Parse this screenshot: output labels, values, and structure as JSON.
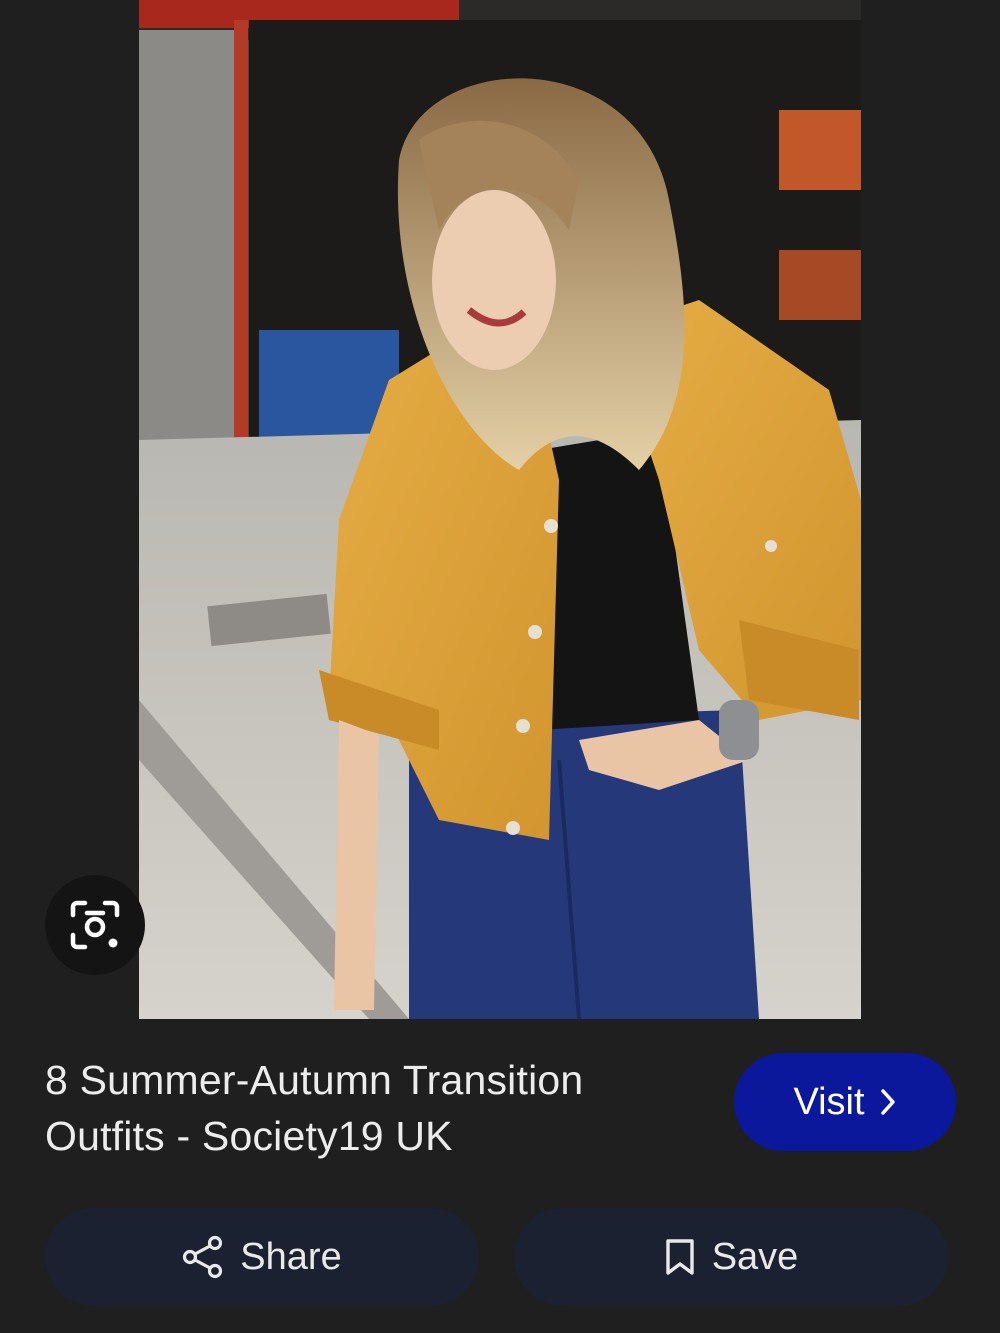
{
  "pin": {
    "title": "8 Summer-Autumn Transition Outfits - Society19 UK",
    "image_icon": "photo"
  },
  "lens": {
    "icon": "camera-search-icon"
  },
  "actions": {
    "visit_label": "Visit",
    "visit_icon": "chevron-right-icon",
    "share_label": "Share",
    "share_icon": "share-icon",
    "save_label": "Save",
    "save_icon": "bookmark-icon"
  },
  "colors": {
    "background": "#1f1f1f",
    "visit_button": "#0b189c",
    "action_button": "#1b2130",
    "text": "#ececec"
  }
}
